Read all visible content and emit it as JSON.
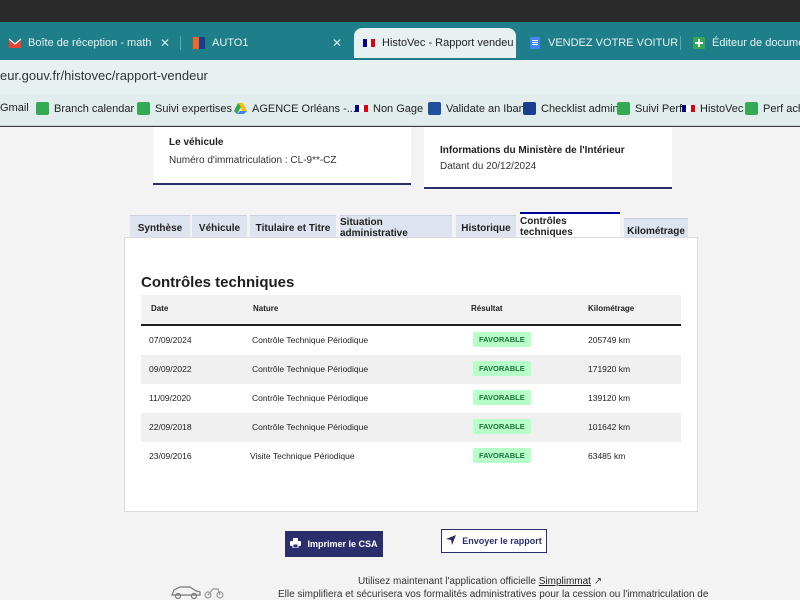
{
  "browser": {
    "tabs": [
      {
        "label": "Boîte de réception - math",
        "icon": "gmail-icon"
      },
      {
        "label": "AUTO1",
        "icon": "auto1-icon"
      },
      {
        "label": "HistoVec - Rapport vendeu",
        "icon": "french-flag-icon"
      },
      {
        "label": "VENDEZ VOTRE VOITURE",
        "icon": "doc-icon"
      },
      {
        "label": "Éditeur de documents d",
        "icon": "plus-doc-icon"
      }
    ],
    "url": "eur.gouv.fr/histovec/rapport-vendeur",
    "bookmarks": [
      {
        "label": "Gmail"
      },
      {
        "label": "Branch calendar"
      },
      {
        "label": "Suivi expertises"
      },
      {
        "label": "AGENCE Orléans -..."
      },
      {
        "label": "Non Gage"
      },
      {
        "label": "Validate an Iban"
      },
      {
        "label": "Checklist admin"
      },
      {
        "label": "Suivi Perf"
      },
      {
        "label": "HistoVec"
      },
      {
        "label": "Perf achete"
      }
    ]
  },
  "vehicle_card": {
    "title": "Le véhicule",
    "registration": "Numéro d'immatriculation : CL-9**-CZ"
  },
  "ministry_card": {
    "title": "Informations du Ministère de l'Intérieur",
    "date": "Datant du 20/12/2024"
  },
  "page_tabs": [
    "Synthèse",
    "Véhicule",
    "Titulaire et Titre",
    "Situation administrative",
    "Historique",
    "Contrôles techniques",
    "Kilométrage"
  ],
  "active_tab_index": 5,
  "controles": {
    "title": "Contrôles techniques",
    "headers": {
      "date": "Date",
      "nature": "Nature",
      "result": "Résultat",
      "km": "Kilométrage"
    },
    "rows": [
      {
        "date": "07/09/2024",
        "nature": "Contrôle Technique Périodique",
        "result": "FAVORABLE",
        "km": "205749 km"
      },
      {
        "date": "09/09/2022",
        "nature": "Contrôle Technique Périodique",
        "result": "FAVORABLE",
        "km": "171920 km"
      },
      {
        "date": "11/09/2020",
        "nature": "Contrôle Technique Périodique",
        "result": "FAVORABLE",
        "km": "139120 km"
      },
      {
        "date": "22/09/2018",
        "nature": "Contrôle Technique Périodique",
        "result": "FAVORABLE",
        "km": "101642 km"
      },
      {
        "date": "23/09/2016",
        "nature": "Visite Technique Périodique",
        "result": "FAVORABLE",
        "km": "63485 km"
      }
    ]
  },
  "buttons": {
    "print": "Imprimer le CSA",
    "send": "Envoyer le rapport"
  },
  "footer": {
    "line1_prefix": "Utilisez maintenant l'application officielle ",
    "line1_link": "Simplimmat",
    "line2": "Elle simplifiera et sécurisera vos formalités administratives pour la cession ou l'immatriculation de"
  },
  "colors": {
    "accent": "#000091",
    "dark_blue": "#2a2f6b",
    "success_bg": "#b8fec9",
    "success_text": "#18753c",
    "browser_teal": "#1e7f8a"
  }
}
